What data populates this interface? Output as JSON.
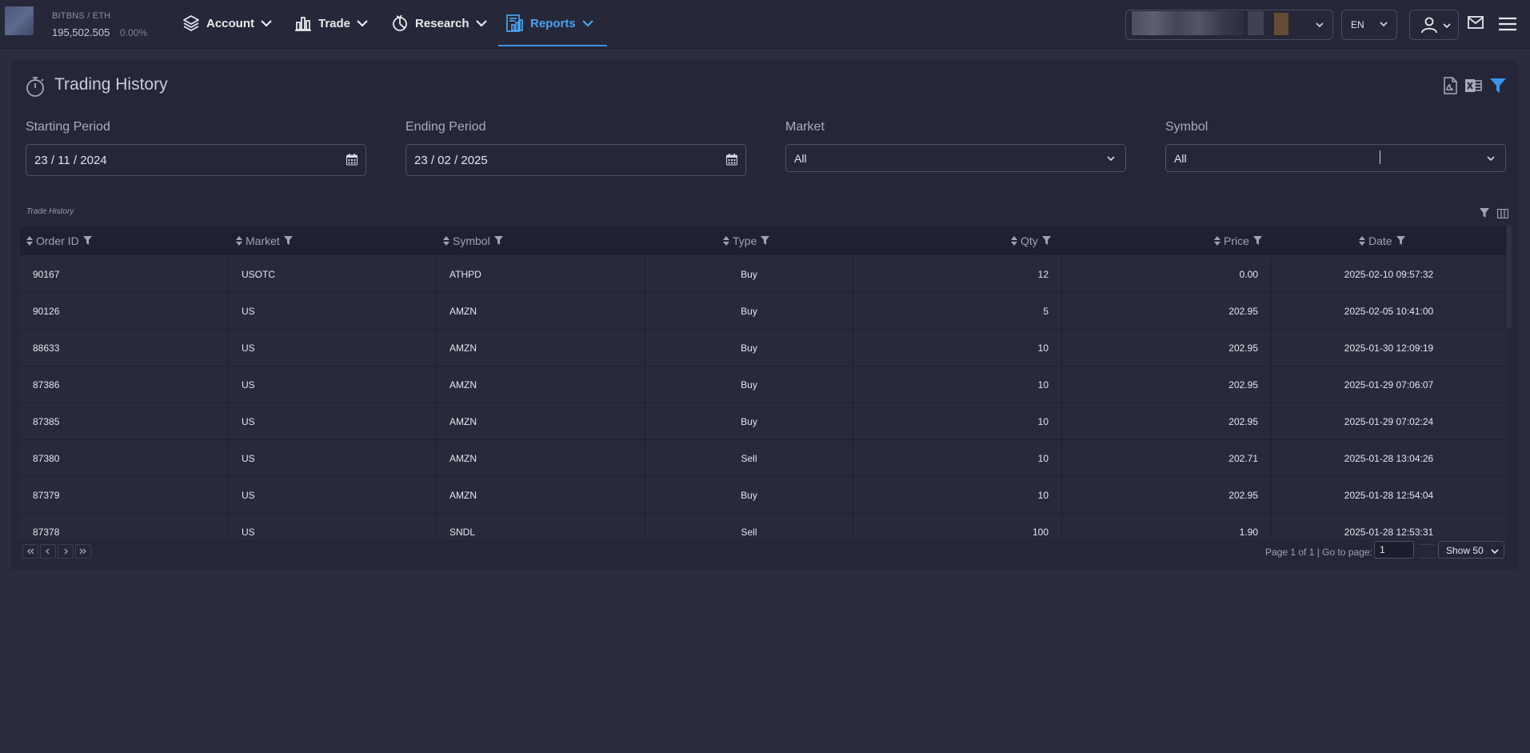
{
  "account": {
    "pair": "BITBNS / ETH",
    "balance": "195,502.505",
    "change": "0.00%"
  },
  "nav": {
    "items": [
      {
        "label": "Account",
        "icon": "layers-icon"
      },
      {
        "label": "Trade",
        "icon": "bar-chart-icon"
      },
      {
        "label": "Research",
        "icon": "pie-chart-icon"
      },
      {
        "label": "Reports",
        "icon": "report-icon",
        "active": true
      }
    ]
  },
  "topbar": {
    "language": "EN",
    "icons": [
      "user-icon",
      "mail-icon",
      "hamburger-menu-icon"
    ]
  },
  "page": {
    "title": "Trading History",
    "title_icon": "stopwatch-icon",
    "action_icons": [
      "pdf-export-icon",
      "excel-export-icon",
      "filter-icon"
    ]
  },
  "filters": {
    "starting_period": {
      "label": "Starting Period",
      "value": "23 / 11 / 2024"
    },
    "ending_period": {
      "label": "Ending Period",
      "value": "23 / 02 / 2025"
    },
    "market": {
      "label": "Market",
      "value": "All"
    },
    "symbol": {
      "label": "Symbol",
      "value": "All"
    }
  },
  "grid": {
    "caption": "Trade History",
    "columns": [
      "Order ID",
      "Market",
      "Symbol",
      "Type",
      "Qty",
      "Price",
      "Date"
    ],
    "rows": [
      {
        "order_id": "90167",
        "market": "USOTC",
        "symbol": "ATHPD",
        "type": "Buy",
        "qty": "12",
        "price": "0.00",
        "date": "2025-02-10 09:57:32"
      },
      {
        "order_id": "90126",
        "market": "US",
        "symbol": "AMZN",
        "type": "Buy",
        "qty": "5",
        "price": "202.95",
        "date": "2025-02-05 10:41:00"
      },
      {
        "order_id": "88633",
        "market": "US",
        "symbol": "AMZN",
        "type": "Buy",
        "qty": "10",
        "price": "202.95",
        "date": "2025-01-30 12:09:19"
      },
      {
        "order_id": "87386",
        "market": "US",
        "symbol": "AMZN",
        "type": "Buy",
        "qty": "10",
        "price": "202.95",
        "date": "2025-01-29 07:06:07"
      },
      {
        "order_id": "87385",
        "market": "US",
        "symbol": "AMZN",
        "type": "Buy",
        "qty": "10",
        "price": "202.95",
        "date": "2025-01-29 07:02:24"
      },
      {
        "order_id": "87380",
        "market": "US",
        "symbol": "AMZN",
        "type": "Sell",
        "qty": "10",
        "price": "202.71",
        "date": "2025-01-28 13:04:26"
      },
      {
        "order_id": "87379",
        "market": "US",
        "symbol": "AMZN",
        "type": "Buy",
        "qty": "10",
        "price": "202.95",
        "date": "2025-01-28 12:54:04"
      },
      {
        "order_id": "87378",
        "market": "US",
        "symbol": "SNDL",
        "type": "Sell",
        "qty": "100",
        "price": "1.90",
        "date": "2025-01-28 12:53:31"
      }
    ]
  },
  "pager": {
    "info": "Page 1 of 1",
    "goto_label": "| Go to page:",
    "goto_value": "1",
    "page_size": "Show 50"
  }
}
